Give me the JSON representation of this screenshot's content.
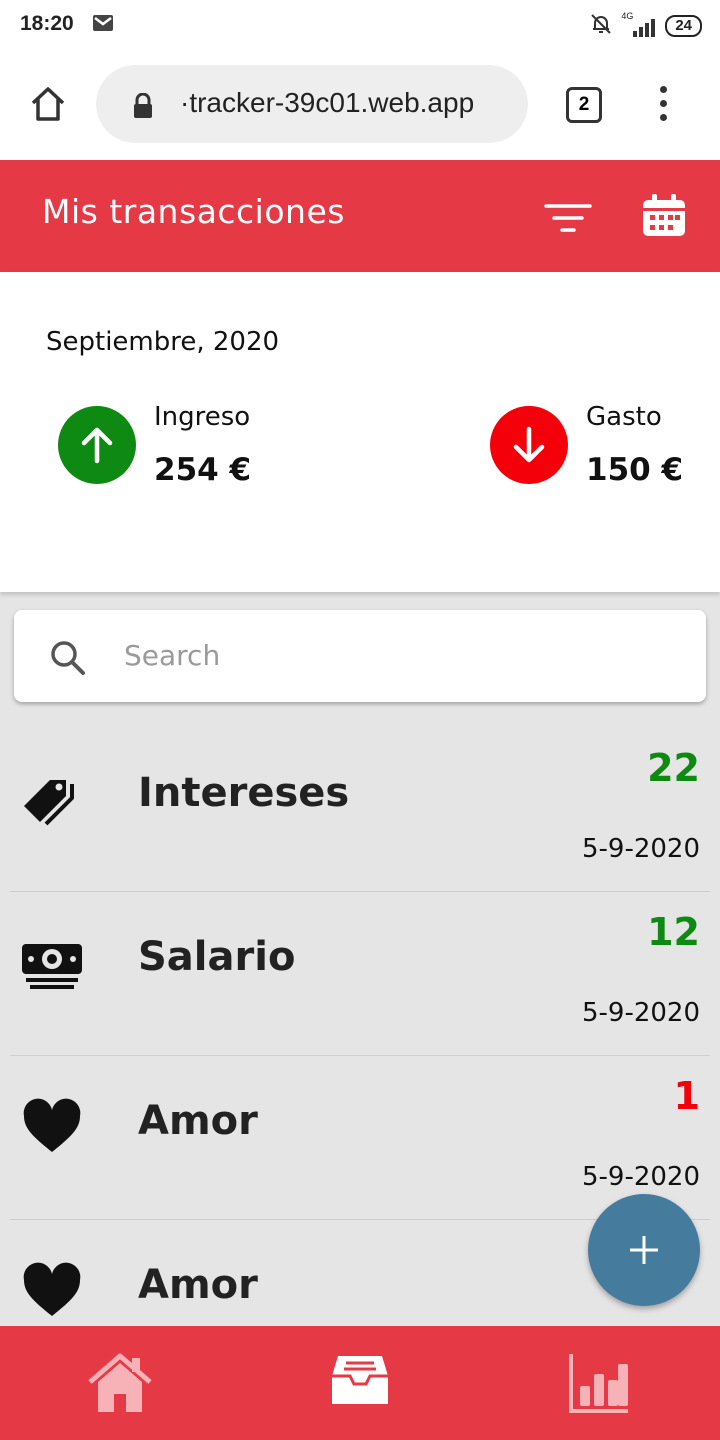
{
  "status_bar": {
    "time": "18:20",
    "network": "4G",
    "battery": "24"
  },
  "browser": {
    "url": "·tracker-39c01.web.app",
    "tab_count": "2"
  },
  "header": {
    "title": "Mis transacciones"
  },
  "summary": {
    "month": "Septiembre, 2020",
    "income": {
      "label": "Ingreso",
      "amount": "254 €"
    },
    "expense": {
      "label": "Gasto",
      "amount": "150 €"
    }
  },
  "search": {
    "placeholder": "Search",
    "value": ""
  },
  "transactions": [
    {
      "name": "Intereses",
      "amount": "22",
      "type": "income",
      "date": "5-9-2020",
      "icon": "tags-icon"
    },
    {
      "name": "Salario",
      "amount": "12",
      "type": "income",
      "date": "5-9-2020",
      "icon": "money-icon"
    },
    {
      "name": "Amor",
      "amount": "1",
      "type": "expense",
      "date": "5-9-2020",
      "icon": "heart-icon"
    },
    {
      "name": "Amor",
      "amount": "",
      "type": "expense",
      "date": "",
      "icon": "heart-icon"
    }
  ],
  "colors": {
    "primary": "#e63946",
    "income": "#0e8a12",
    "expense": "#f4000b",
    "fab": "#457b9d"
  }
}
